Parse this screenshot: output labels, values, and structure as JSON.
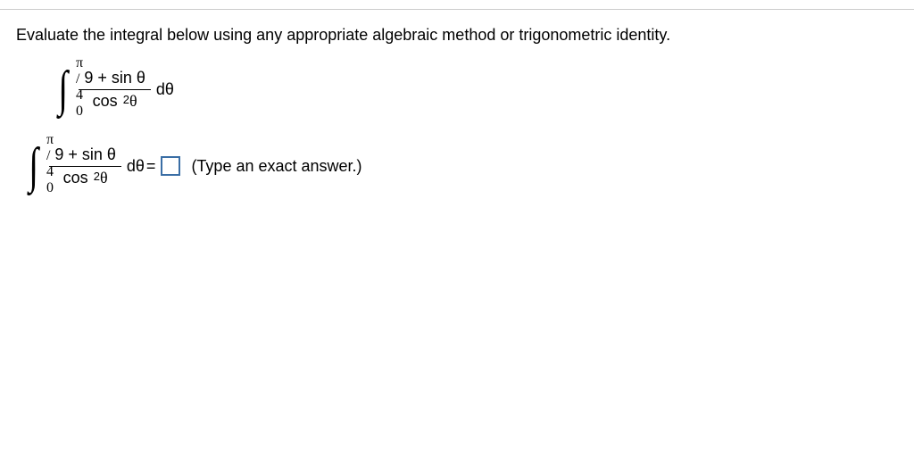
{
  "question": {
    "prompt": "Evaluate the integral below using any appropriate algebraic method or trigonometric identity."
  },
  "integral": {
    "upper_limit": "π / 4",
    "lower_limit": "0",
    "numerator": "9 + sin θ",
    "denominator_base": "cos",
    "denominator_exp": "2",
    "denominator_var": "θ",
    "differential": "dθ"
  },
  "answer": {
    "equals": "=",
    "hint": "(Type an exact answer.)"
  }
}
